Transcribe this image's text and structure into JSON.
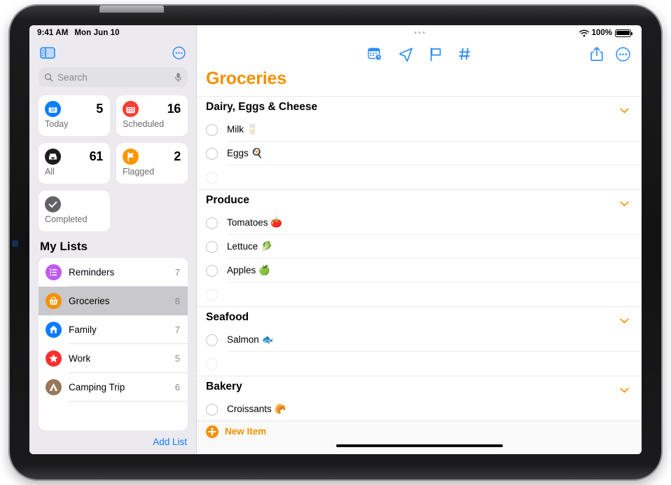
{
  "status_bar": {
    "time": "9:41 AM",
    "date": "Mon Jun 10",
    "battery_percent": "100%",
    "wifi_icon": "wifi-icon",
    "battery_icon": "battery-full-icon"
  },
  "sidebar": {
    "toggle_icon": "sidebar-toggle-icon",
    "more_icon": "more-circle-icon",
    "search": {
      "placeholder": "Search",
      "value": "",
      "search_icon": "search-icon",
      "mic_icon": "microphone-icon"
    },
    "smart_lists": [
      {
        "label": "Today",
        "count": "5",
        "icon": "calendar-today-icon",
        "color": "#0a7cff",
        "day": "10"
      },
      {
        "label": "Scheduled",
        "count": "16",
        "icon": "calendar-icon",
        "color": "#ff3b30"
      },
      {
        "label": "All",
        "count": "61",
        "icon": "tray-icon",
        "color": "#1c1c1e"
      },
      {
        "label": "Flagged",
        "count": "2",
        "icon": "flag-icon",
        "color": "#ff9500"
      },
      {
        "label": "Completed",
        "count": "",
        "icon": "checkmark-icon",
        "color": "#636366"
      }
    ],
    "my_lists_title": "My Lists",
    "lists": [
      {
        "name": "Reminders",
        "count": "7",
        "icon": "list-bullet-icon",
        "color": "#bf5af2",
        "selected": false
      },
      {
        "name": "Groceries",
        "count": "8",
        "icon": "basket-icon",
        "color": "#f59000",
        "selected": true
      },
      {
        "name": "Family",
        "count": "7",
        "icon": "house-icon",
        "color": "#0a7cff",
        "selected": false
      },
      {
        "name": "Work",
        "count": "5",
        "icon": "star-icon",
        "color": "#ff2d2d",
        "selected": false
      },
      {
        "name": "Camping Trip",
        "count": "6",
        "icon": "tent-icon",
        "color": "#97785a",
        "selected": false
      }
    ],
    "add_list_label": "Add List"
  },
  "main": {
    "toolbar": {
      "center_icons": [
        {
          "name": "calendar-clock-icon",
          "label": "Date & Time"
        },
        {
          "name": "location-arrow-icon",
          "label": "Location"
        },
        {
          "name": "flag-icon",
          "label": "Flag"
        },
        {
          "name": "hashtag-icon",
          "label": "Tags"
        }
      ],
      "right_icons": [
        {
          "name": "share-icon",
          "label": "Share"
        },
        {
          "name": "more-circle-icon",
          "label": "More"
        }
      ]
    },
    "title": "Groceries",
    "title_color": "#f59000",
    "sections": [
      {
        "title": "Dairy, Eggs & Cheese",
        "chevron_icon": "chevron-down-icon",
        "items": [
          {
            "text": "Milk 🥛",
            "empty": false
          },
          {
            "text": "Eggs 🍳",
            "empty": false
          },
          {
            "text": "",
            "empty": true
          }
        ]
      },
      {
        "title": "Produce",
        "chevron_icon": "chevron-down-icon",
        "items": [
          {
            "text": "Tomatoes 🍅",
            "empty": false
          },
          {
            "text": "Lettuce 🥬",
            "empty": false
          },
          {
            "text": "Apples 🍏",
            "empty": false
          },
          {
            "text": "",
            "empty": true
          }
        ]
      },
      {
        "title": "Seafood",
        "chevron_icon": "chevron-down-icon",
        "items": [
          {
            "text": "Salmon 🐟",
            "empty": false
          },
          {
            "text": "",
            "empty": true
          }
        ]
      },
      {
        "title": "Bakery",
        "chevron_icon": "chevron-down-icon",
        "items": [
          {
            "text": "Croissants 🥐",
            "empty": false
          }
        ]
      }
    ],
    "new_item": {
      "label": "New Item",
      "icon": "plus-circle-icon",
      "color": "#f59000"
    }
  }
}
